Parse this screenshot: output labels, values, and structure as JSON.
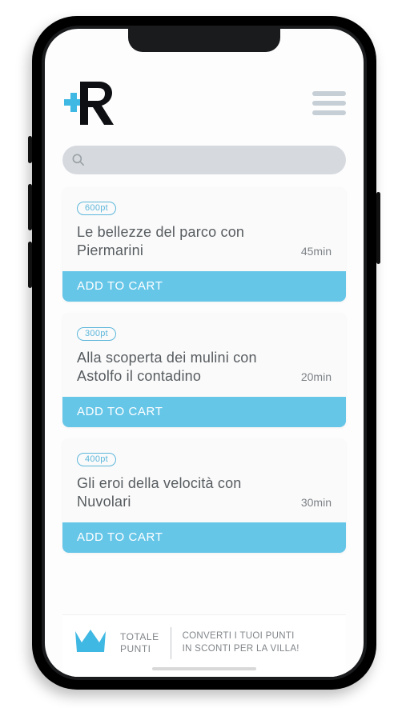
{
  "search": {
    "placeholder": ""
  },
  "items": [
    {
      "points": "600pt",
      "title": "Le bellezze del parco con Piermarini",
      "duration": "45min",
      "button": "ADD TO CART"
    },
    {
      "points": "300pt",
      "title": "Alla scoperta dei mulini con Astolfo il contadino",
      "duration": "20min",
      "button": "ADD TO CART"
    },
    {
      "points": "400pt",
      "title": "Gli eroi della velocità con Nuvolari",
      "duration": "30min",
      "button": "ADD TO CART"
    }
  ],
  "footer": {
    "line1": "TOTALE",
    "line2": "PUNTI",
    "cta1": "CONVERTI I TUOI PUNTI",
    "cta2": "IN SCONTI PER LA VILLA!"
  }
}
